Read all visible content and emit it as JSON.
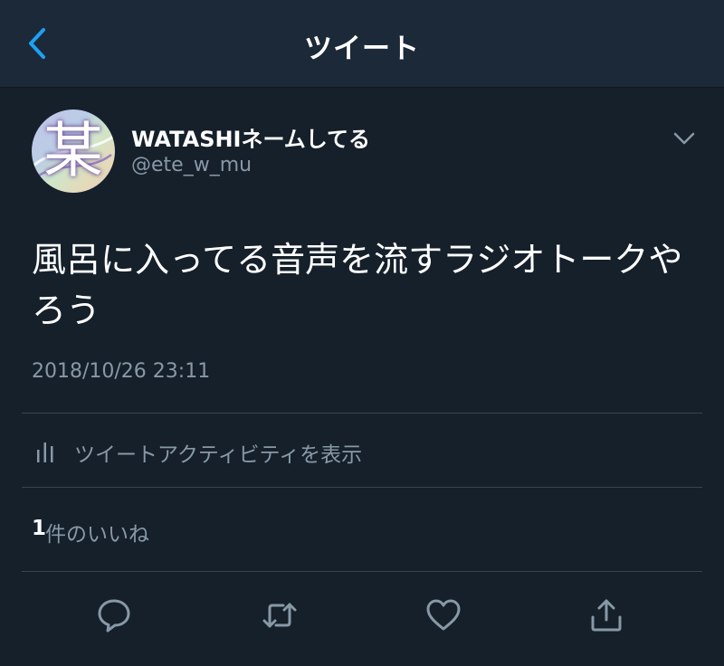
{
  "header": {
    "title": "ツイート",
    "back_icon": "chevron-left-icon"
  },
  "tweet": {
    "author_name": "WATASHIネームしてる",
    "author_handle": "@ete_w_mu",
    "avatar_glyph": "某",
    "more_icon": "chevron-down-icon",
    "text": "風呂に入ってる音声を流すラジオトークやろう",
    "timestamp": "2018/10/26 23:11"
  },
  "activity": {
    "icon": "bar-chart-icon",
    "label": "ツイートアクティビティを表示"
  },
  "likes": {
    "count": "1",
    "label": "件のいいね"
  },
  "actions": [
    {
      "icon": "reply-icon"
    },
    {
      "icon": "retweet-icon"
    },
    {
      "icon": "heart-icon"
    },
    {
      "icon": "share-icon"
    }
  ],
  "colors": {
    "background": "#15202b",
    "header_background": "#1c2938",
    "accent": "#1da1f2",
    "secondary_text": "#8899a6",
    "divider": "#38444d"
  }
}
